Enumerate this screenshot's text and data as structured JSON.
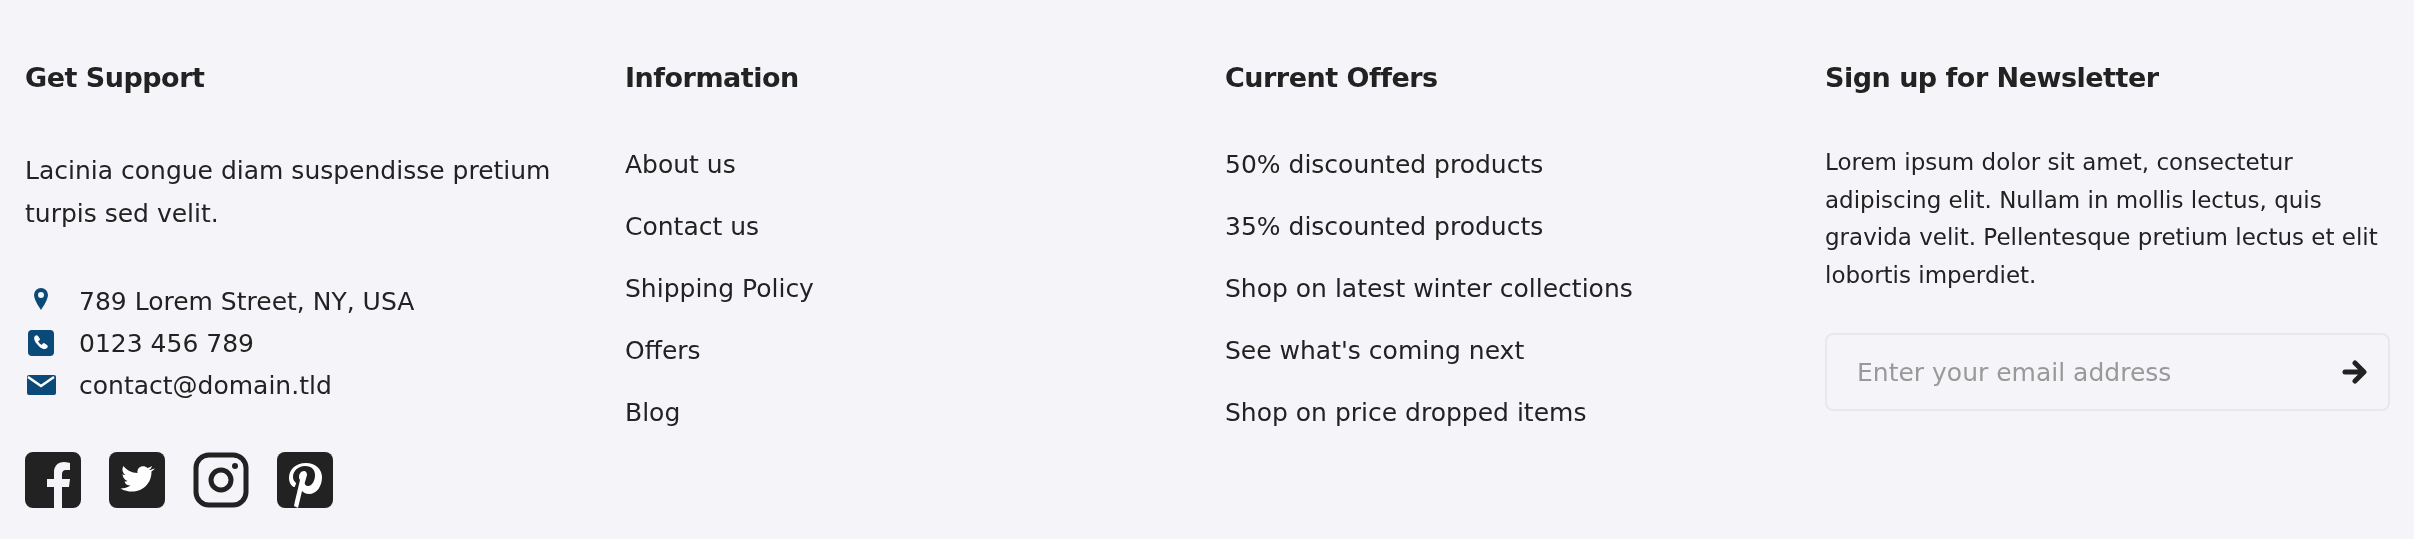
{
  "support": {
    "heading": "Get Support",
    "description": "Lacinia congue diam suspendisse pretium turpis sed velit.",
    "contacts": [
      {
        "kind": "location",
        "text": "789 Lorem Street, NY, USA"
      },
      {
        "kind": "phone",
        "text": "0123 456 789"
      },
      {
        "kind": "email",
        "text": "contact@domain.tld"
      }
    ],
    "social": [
      {
        "kind": "facebook"
      },
      {
        "kind": "twitter"
      },
      {
        "kind": "instagram"
      },
      {
        "kind": "pinterest"
      }
    ]
  },
  "information": {
    "heading": "Information",
    "links": [
      "About us",
      "Contact us",
      "Shipping Policy",
      "Offers",
      "Blog"
    ]
  },
  "offers": {
    "heading": "Current Offers",
    "links": [
      "50% discounted products",
      "35% discounted products",
      "Shop on latest winter collections",
      "See what's coming next",
      "Shop on price dropped items"
    ]
  },
  "newsletter": {
    "heading": "Sign up for Newsletter",
    "description": "Lorem ipsum dolor sit amet, consectetur adipiscing elit. Nullam in mollis lectus, quis gravida velit. Pellentesque pretium lectus et elit lobortis imperdiet.",
    "placeholder": "Enter your email address"
  }
}
